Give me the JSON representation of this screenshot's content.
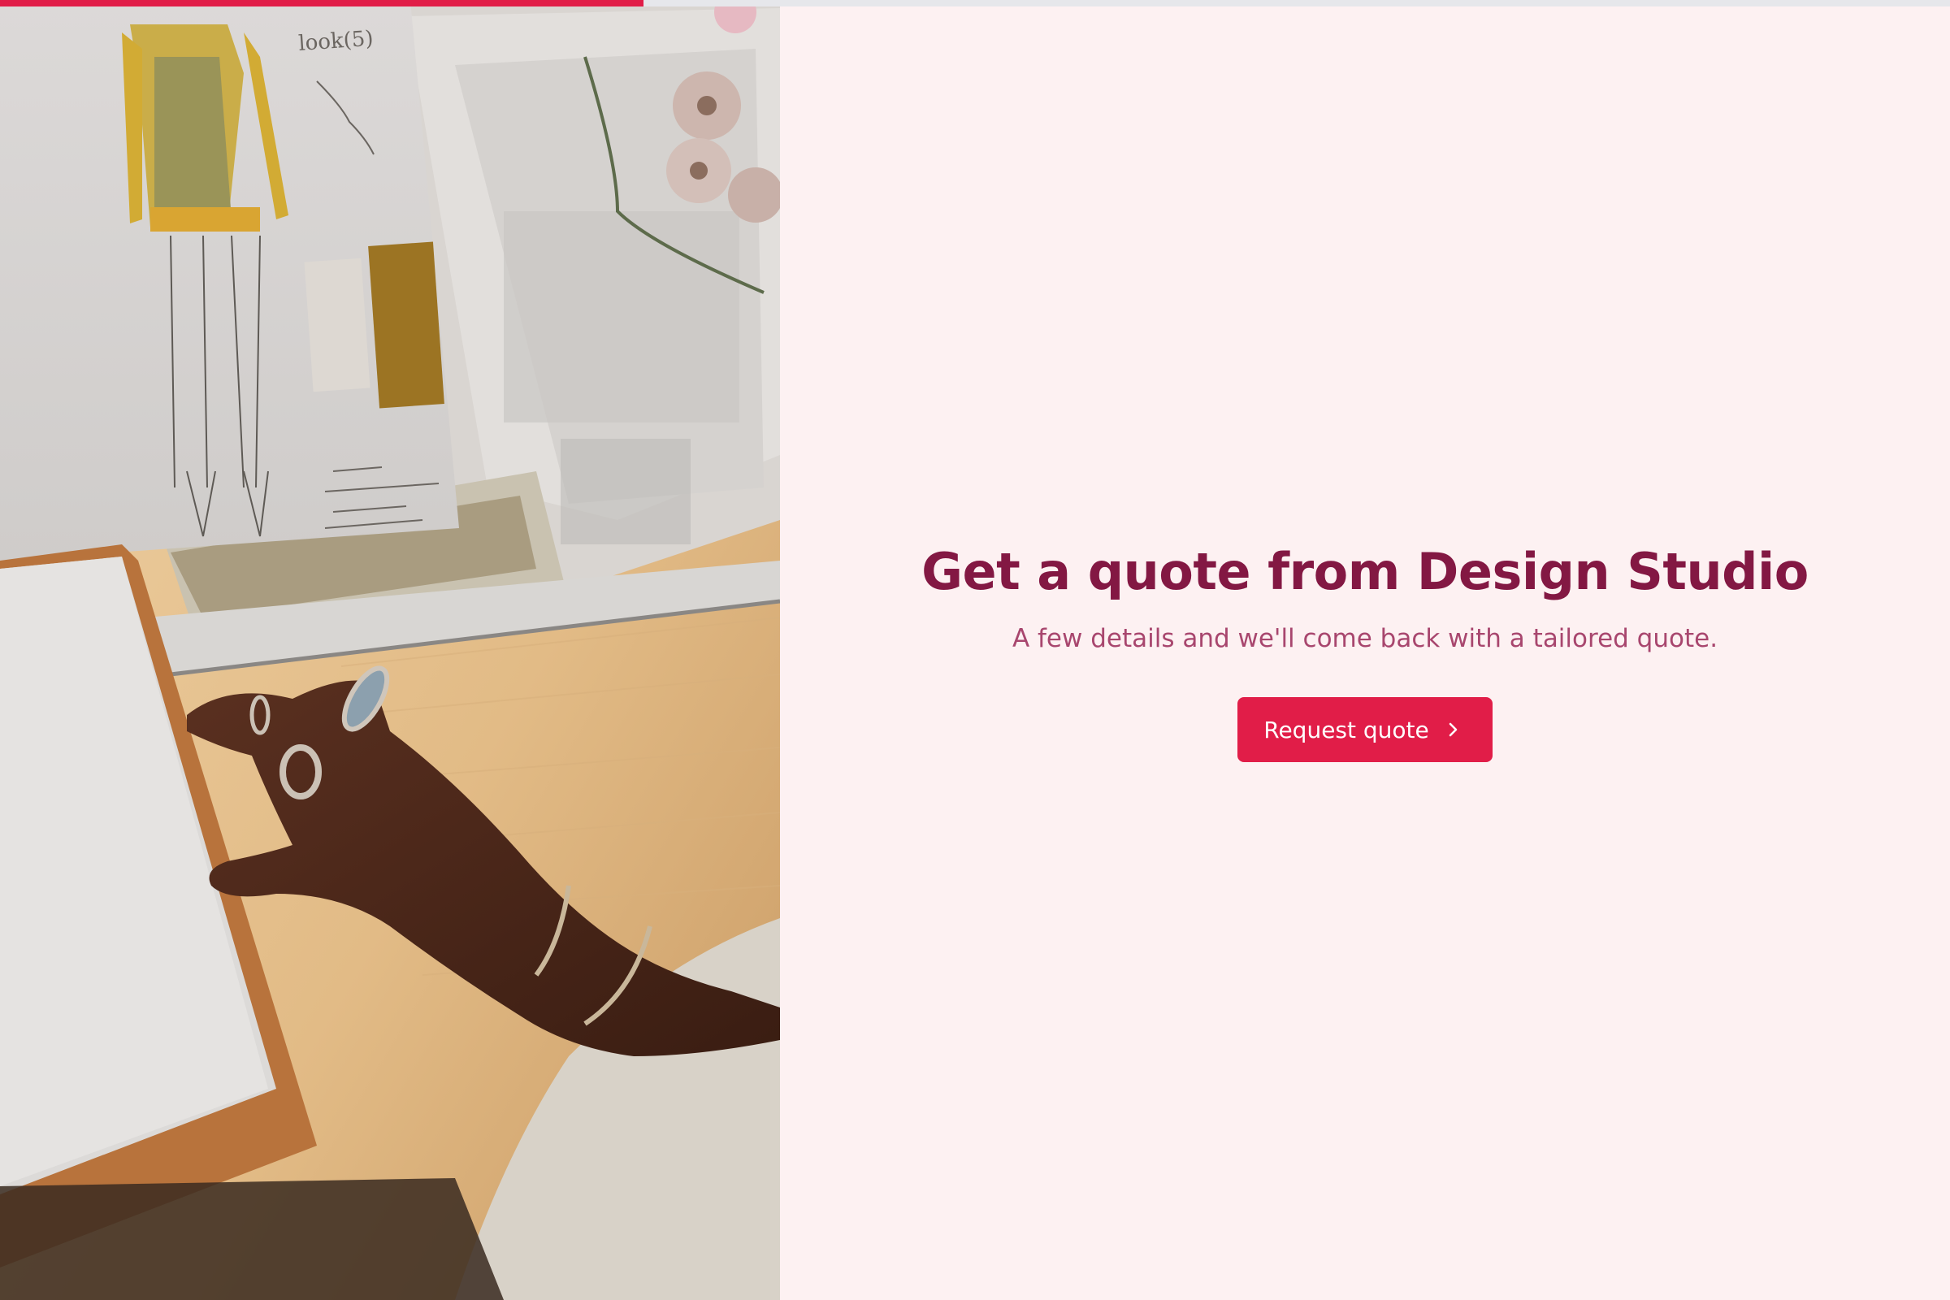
{
  "progress": {
    "fraction": 0.33,
    "fill_color": "#e11d48",
    "track_color": "#e6e7eb"
  },
  "photo": {
    "sketch_note": "look(5)"
  },
  "hero": {
    "title": "Get a quote from Design Studio",
    "subtitle": "A few details and we'll come back with a tailored quote.",
    "cta_label": "Request quote",
    "cta_icon": "chevron-right-icon"
  },
  "colors": {
    "accent": "#e11d48",
    "title": "#831843",
    "subtitle": "#a8466e",
    "background": "#fdf1f2"
  }
}
